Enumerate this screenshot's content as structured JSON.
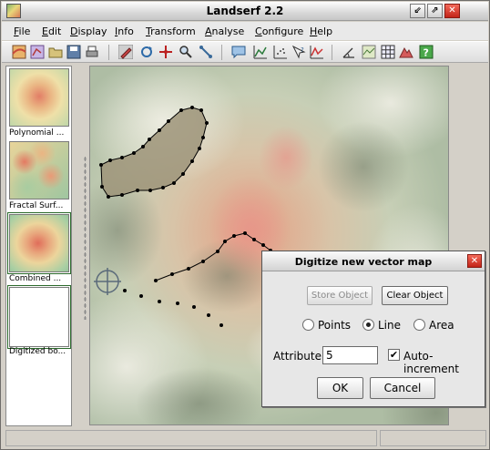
{
  "window": {
    "title": "Landserf 2.2"
  },
  "window_buttons": {
    "minimize": "⇙",
    "maximize": "⇗",
    "close": "✕"
  },
  "menu": [
    {
      "pre": "",
      "u": "F",
      "post": "ile"
    },
    {
      "pre": "",
      "u": "E",
      "post": "dit"
    },
    {
      "pre": "",
      "u": "D",
      "post": "isplay"
    },
    {
      "pre": "",
      "u": "I",
      "post": "nfo"
    },
    {
      "pre": "",
      "u": "T",
      "post": "ransform"
    },
    {
      "pre": "",
      "u": "A",
      "post": "nalyse"
    },
    {
      "pre": "",
      "u": "C",
      "post": "onfigure"
    },
    {
      "pre": "",
      "u": "H",
      "post": "elp"
    }
  ],
  "toolbar_icons": [
    "new-raster-icon",
    "new-vector-icon",
    "open-icon",
    "save-icon",
    "print-icon",
    "digitize-icon",
    "refresh-icon",
    "zoom-icon",
    "search-icon",
    "edit-vector-icon",
    "info-icon",
    "profile-icon",
    "scatter-icon",
    "query-icon",
    "chart-icon",
    "slope-icon",
    "terrain-icon",
    "grid-icon",
    "mountain-icon",
    "help-icon"
  ],
  "thumbnails": [
    {
      "label": "Polynomial ...",
      "kind": "poly"
    },
    {
      "label": "Fractal Surf...",
      "kind": "fractal"
    },
    {
      "label": "Combined ...",
      "kind": "combined"
    },
    {
      "label": "Digitized bo...",
      "kind": "digitized"
    }
  ],
  "dialog": {
    "title": "Digitize new vector map",
    "store_label": "Store Object",
    "clear_label": "Clear Object",
    "radio_points": "Points",
    "radio_line": "Line",
    "radio_area": "Area",
    "selected_type": "Line",
    "attribute_label": "Attribute:",
    "attribute_value": "5",
    "auto_increment_label": "Auto-increment",
    "auto_increment_checked": true,
    "ok_label": "OK",
    "cancel_label": "Cancel",
    "close_glyph": "✕"
  },
  "colors": {
    "area_fill": "#9d9479",
    "vector_stroke": "#000000"
  }
}
